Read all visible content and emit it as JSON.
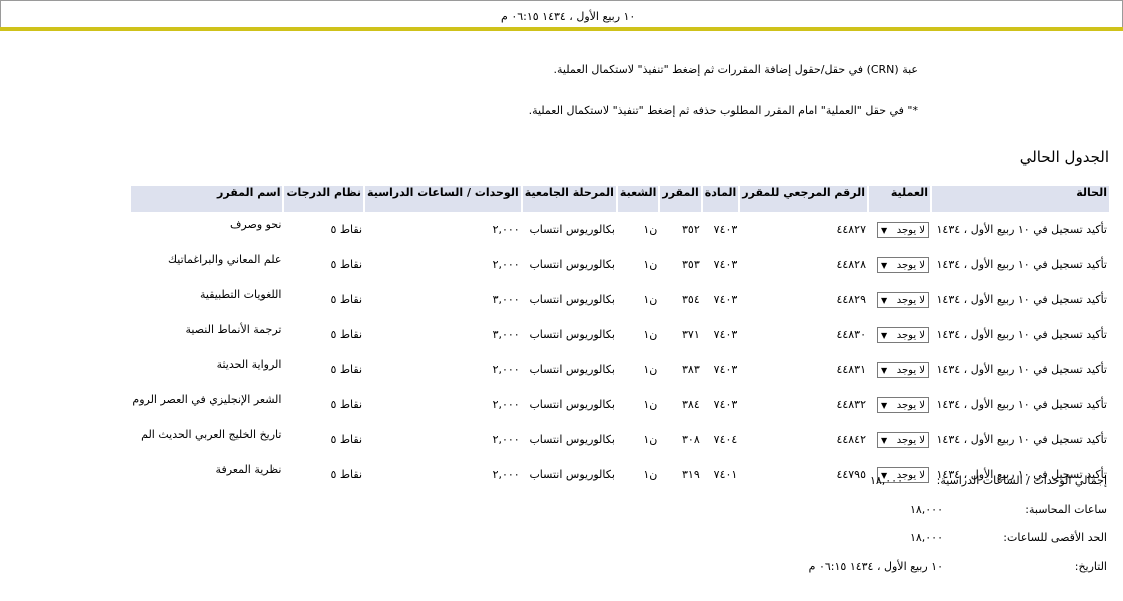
{
  "header": {
    "date_time": "١٠ ربيع الأول ، ١٤٣٤ ٠٦:١٥ م"
  },
  "instructions": {
    "line1": "عبة (CRN) في حقل/حقول إضافة المقررات ثم إضغط \"تنفيذ\" لاستكمال العملية.",
    "line2": "*\" في حقل \"العملية\" امام المقرر المطلوب حذفه ثم إضغط \"تنفيذ\" لاستكمال العملية."
  },
  "schedule": {
    "title": "الجدول الحالي",
    "columns": {
      "status": "الحالة",
      "action": "العملية",
      "crn": "الرقم المرجعي للمقرر",
      "subject": "المادة",
      "course": "المقرر",
      "section": "الشعبة",
      "level": "المرحلة الجامعية",
      "credits": "الوحدات / الساعات الدراسية",
      "grade_mode": "نظام الدرجات",
      "course_title": "اسم المقرر"
    },
    "action_default": "لا يوجد",
    "rows": [
      {
        "status": "تأكيد تسجيل في ١٠ ربيع الأول ، ١٤٣٤",
        "crn": "٤٤٨٢٧",
        "subject": "٧٤٠٣",
        "course": "٣٥٢",
        "section": "ن١",
        "level": "بكالوريوس انتساب",
        "credits": "٢,٠٠٠",
        "grade_mode": "نقاط ٥",
        "course_title": "نحو وصرف"
      },
      {
        "status": "تأكيد تسجيل في ١٠ ربيع الأول ، ١٤٣٤",
        "crn": "٤٤٨٢٨",
        "subject": "٧٤٠٣",
        "course": "٣٥٣",
        "section": "ن١",
        "level": "بكالوريوس انتساب",
        "credits": "٢,٠٠٠",
        "grade_mode": "نقاط ٥",
        "course_title": "علم المعاني والبراغماتيك"
      },
      {
        "status": "تأكيد تسجيل في ١٠ ربيع الأول ، ١٤٣٤",
        "crn": "٤٤٨٢٩",
        "subject": "٧٤٠٣",
        "course": "٣٥٤",
        "section": "ن١",
        "level": "بكالوريوس انتساب",
        "credits": "٣,٠٠٠",
        "grade_mode": "نقاط ٥",
        "course_title": "اللغويات التطبيقية"
      },
      {
        "status": "تأكيد تسجيل في ١٠ ربيع الأول ، ١٤٣٤",
        "crn": "٤٤٨٣٠",
        "subject": "٧٤٠٣",
        "course": "٣٧١",
        "section": "ن١",
        "level": "بكالوريوس انتساب",
        "credits": "٣,٠٠٠",
        "grade_mode": "نقاط ٥",
        "course_title": "ترجمة الأنماط النصية"
      },
      {
        "status": "تأكيد تسجيل في ١٠ ربيع الأول ، ١٤٣٤",
        "crn": "٤٤٨٣١",
        "subject": "٧٤٠٣",
        "course": "٣٨٣",
        "section": "ن١",
        "level": "بكالوريوس انتساب",
        "credits": "٢,٠٠٠",
        "grade_mode": "نقاط ٥",
        "course_title": "الرواية الحديثة"
      },
      {
        "status": "تأكيد تسجيل في ١٠ ربيع الأول ، ١٤٣٤",
        "crn": "٤٤٨٣٢",
        "subject": "٧٤٠٣",
        "course": "٣٨٤",
        "section": "ن١",
        "level": "بكالوريوس انتساب",
        "credits": "٢,٠٠٠",
        "grade_mode": "نقاط ٥",
        "course_title": "الشعر الإنجليزي في العصر الروم"
      },
      {
        "status": "تأكيد تسجيل في ١٠ ربيع الأول ، ١٤٣٤",
        "crn": "٤٤٨٤٢",
        "subject": "٧٤٠٤",
        "course": "٣٠٨",
        "section": "ن١",
        "level": "بكالوريوس انتساب",
        "credits": "٢,٠٠٠",
        "grade_mode": "نقاط ٥",
        "course_title": "تاريخ الخليج العربي الحديث الم"
      },
      {
        "status": "تأكيد تسجيل في ١٠ ربيع الأول ، ١٤٣٤",
        "crn": "٤٤٧٩٥",
        "subject": "٧٤٠١",
        "course": "٣١٩",
        "section": "ن١",
        "level": "بكالوريوس انتساب",
        "credits": "٢,٠٠٠",
        "grade_mode": "نقاط ٥",
        "course_title": "نظرية المعرفة"
      }
    ]
  },
  "totals": {
    "total_credits_label": "إجمالي الوحدات / الساعات الدراسية:",
    "total_credits_value": "١٨,٠٠٠",
    "billing_hours_label": "ساعات المحاسبة:",
    "billing_hours_value": "١٨,٠٠٠",
    "max_hours_label": "الحد الأقصى للساعات:",
    "max_hours_value": "١٨,٠٠٠",
    "date_label": "التاريخ:",
    "date_value": "١٠ ربيع الأول ، ١٤٣٤ ٠٦:١٥ م"
  },
  "icons": {
    "dropdown": "chevron-down-icon"
  },
  "colors": {
    "header_rule": "#cfc21a",
    "table_header_bg": "#dde1ee"
  }
}
